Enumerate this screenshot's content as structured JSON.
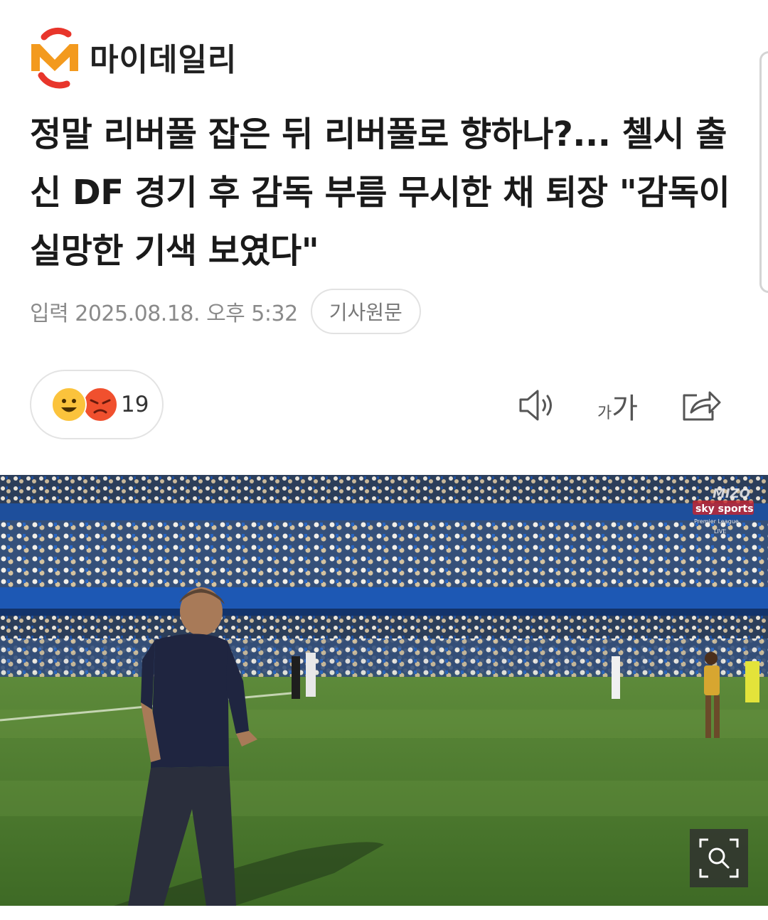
{
  "brand": {
    "name": "마이데일리",
    "colors": {
      "orange": "#F39A1E",
      "red": "#E8352B"
    }
  },
  "article": {
    "title": "정말 리버풀 잡은 뒤 리버풀로 향하나?... 첼시 출신 DF 경기 후 감독 부름 무시한 채 퇴장 \"감독이 실망한 기색 보였다\"",
    "date": "입력 2025.08.18. 오후 5:32",
    "original_label": "기사원문"
  },
  "reactions": {
    "count": "19",
    "icons": [
      "smile-emoji-icon",
      "angry-emoji-icon"
    ]
  },
  "toolbar": {
    "icons": [
      "speaker-icon",
      "font-size-icon",
      "share-icon"
    ],
    "font_small": "가",
    "font_large": "가"
  },
  "image": {
    "broadcast_logo_top": "MIZO",
    "broadcast_logo_main": "sky sports",
    "broadcast_logo_sub": "Premier League",
    "broadcast_logo_live": "LIVE",
    "zoom_icon": "zoom-icon"
  }
}
